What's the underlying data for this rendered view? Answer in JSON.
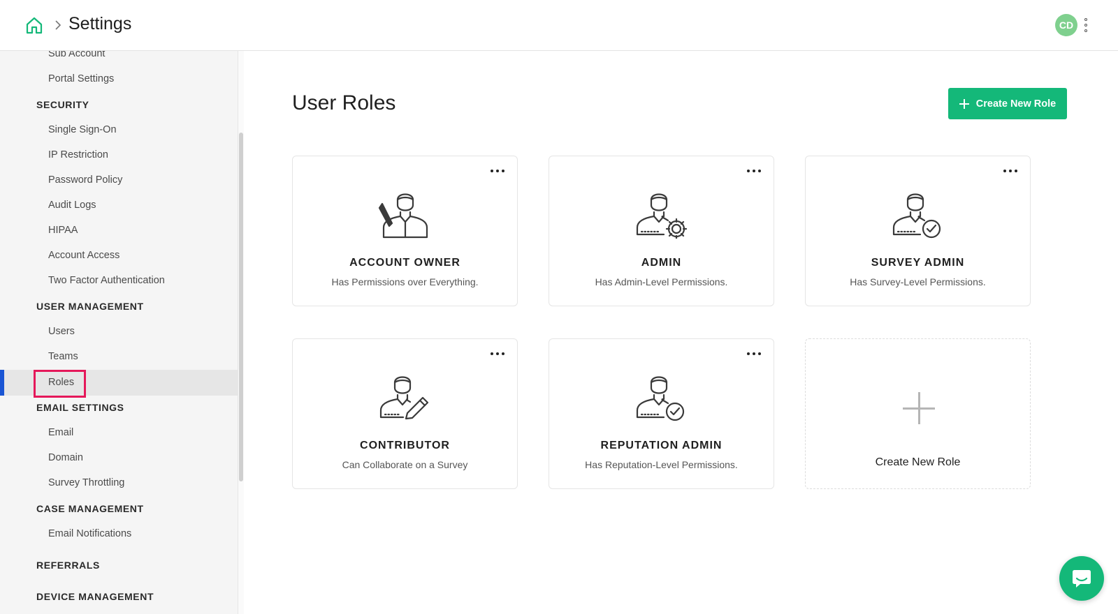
{
  "header": {
    "title": "Settings",
    "avatar_initials": "CD",
    "avatar_color": "#7fd08e",
    "home_icon": "home-icon",
    "menu_icon": "kebab-menu-icon"
  },
  "sidebar": {
    "items_top": [
      "Sub Account",
      "Portal Settings"
    ],
    "sections": [
      {
        "title": "SECURITY",
        "items": [
          "Single Sign-On",
          "IP Restriction",
          "Password Policy",
          "Audit Logs",
          "HIPAA",
          "Account Access",
          "Two Factor Authentication"
        ]
      },
      {
        "title": "USER MANAGEMENT",
        "items": [
          "Users",
          "Teams",
          "Roles"
        ]
      },
      {
        "title": "EMAIL SETTINGS",
        "items": [
          "Email",
          "Domain",
          "Survey Throttling"
        ]
      },
      {
        "title": "CASE MANAGEMENT",
        "items": [
          "Email Notifications"
        ]
      },
      {
        "title": "REFERRALS",
        "items": []
      },
      {
        "title": "DEVICE MANAGEMENT",
        "items": []
      }
    ],
    "active_item": "Roles",
    "accent_color": "#1a55d4",
    "highlight_color": "#e5185a"
  },
  "main": {
    "title": "User Roles",
    "create_button_label": "Create New Role",
    "brand_color": "#14b879",
    "roles": [
      {
        "name": "ACCOUNT OWNER",
        "description": "Has Permissions over Everything.",
        "icon": "account-owner-icon"
      },
      {
        "name": "ADMIN",
        "description": "Has Admin-Level Permissions.",
        "icon": "admin-gear-icon"
      },
      {
        "name": "SURVEY ADMIN",
        "description": "Has Survey-Level Permissions.",
        "icon": "survey-admin-check-icon"
      },
      {
        "name": "CONTRIBUTOR",
        "description": "Can Collaborate on a Survey",
        "icon": "contributor-pencil-icon"
      },
      {
        "name": "REPUTATION ADMIN",
        "description": "Has Reputation-Level Permissions.",
        "icon": "reputation-admin-check-icon"
      }
    ],
    "new_role_card_label": "Create New Role"
  },
  "chat": {
    "icon": "chat-bubble-icon"
  }
}
